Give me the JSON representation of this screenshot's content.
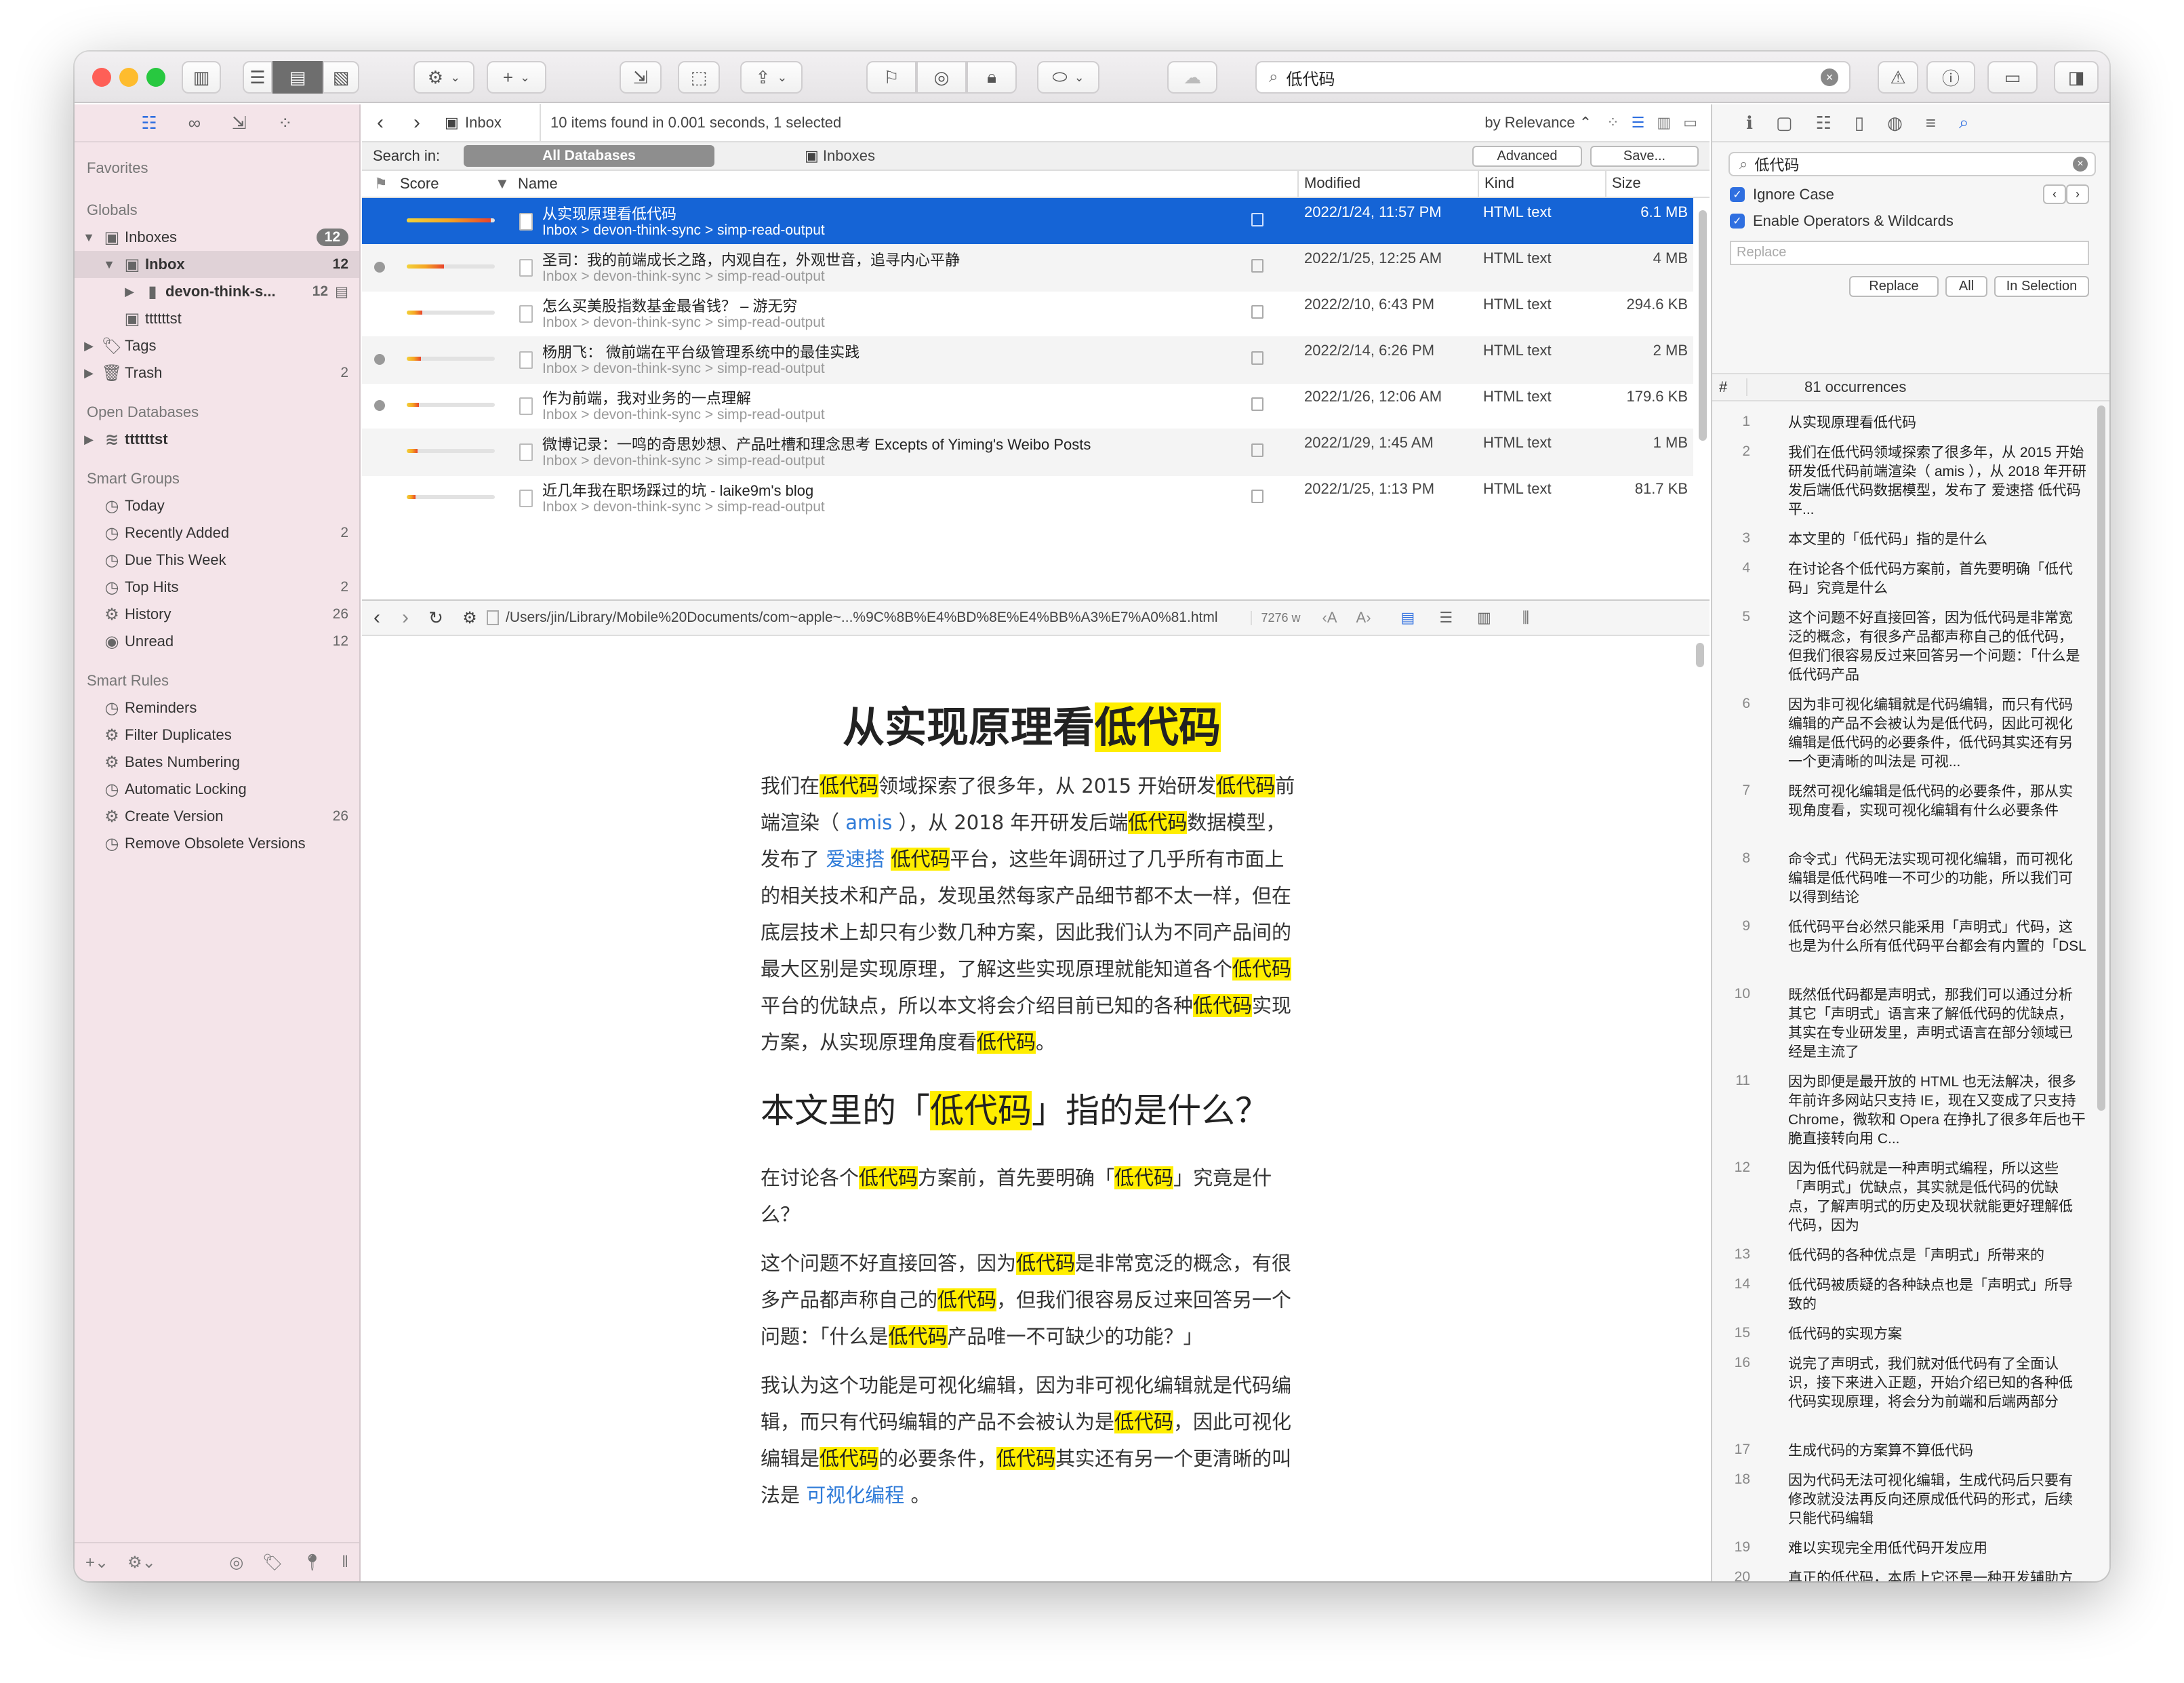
{
  "toolbar": {
    "search_value": "低代码",
    "icons": [
      "sidebar-toggle-icon",
      "view-list-icon",
      "view-split-icon",
      "view-columns-icon",
      "gear-icon",
      "plus-icon",
      "import-icon",
      "capture-icon",
      "share-icon",
      "flag-icon",
      "mark-icon",
      "lock-icon",
      "label-icon",
      "cloud-icon",
      "warning-icon",
      "info-icon",
      "layout-icon",
      "inspector-icon"
    ]
  },
  "sidebar": {
    "favorites_heading": "Favorites",
    "globals_heading": "Globals",
    "globals": [
      {
        "label": "Inboxes",
        "count": "12"
      },
      {
        "label": "Inbox",
        "count": "12"
      },
      {
        "label": "devon-think-s...",
        "count": "12"
      },
      {
        "label": "ttttttst",
        "count": ""
      },
      {
        "label": "Tags",
        "count": ""
      },
      {
        "label": "Trash",
        "count": "2"
      }
    ],
    "open_db_heading": "Open Databases",
    "open_dbs": [
      {
        "label": "ttttttst"
      }
    ],
    "smart_groups_heading": "Smart Groups",
    "smart_groups": [
      {
        "label": "Today",
        "count": ""
      },
      {
        "label": "Recently Added",
        "count": "2"
      },
      {
        "label": "Due This Week",
        "count": ""
      },
      {
        "label": "Top Hits",
        "count": "2"
      },
      {
        "label": "History",
        "count": "26"
      },
      {
        "label": "Unread",
        "count": "12"
      }
    ],
    "smart_rules_heading": "Smart Rules",
    "smart_rules": [
      {
        "label": "Reminders",
        "count": ""
      },
      {
        "label": "Filter Duplicates",
        "count": ""
      },
      {
        "label": "Bates Numbering",
        "count": ""
      },
      {
        "label": "Automatic Locking",
        "count": ""
      },
      {
        "label": "Create Version",
        "count": "26"
      },
      {
        "label": "Remove Obsolete Versions",
        "count": ""
      }
    ]
  },
  "list": {
    "location": "Inbox",
    "status": "10 items found in 0.001 seconds, 1 selected",
    "sort": "by Relevance",
    "search_in_label": "Search in:",
    "scope_all": "All Databases",
    "scope_inboxes": "Inboxes",
    "advanced_label": "Advanced",
    "save_label": "Save...",
    "columns": {
      "score": "Score",
      "name": "Name",
      "modified": "Modified",
      "kind": "Kind",
      "size": "Size"
    },
    "rows": [
      {
        "title": "从实现原理看低代码",
        "path": "Inbox > devon-think-sync > simp-read-output",
        "modified": "2022/1/24, 11:57 PM",
        "kind": "HTML text",
        "size": "6.1 MB",
        "score": 0.95,
        "flag": false,
        "selected": true
      },
      {
        "title": "圣司：我的前端成长之路，内观自在，外观世音，追寻内心平静",
        "path": "Inbox > devon-think-sync > simp-read-output",
        "modified": "2022/1/25, 12:25 AM",
        "kind": "HTML text",
        "size": "4 MB",
        "score": 0.42,
        "flag": true,
        "selected": false
      },
      {
        "title": "怎么买美股指数基金最省钱？ – 游无穷",
        "path": "Inbox > devon-think-sync > simp-read-output",
        "modified": "2022/2/10, 6:43 PM",
        "kind": "HTML text",
        "size": "294.6 KB",
        "score": 0.18,
        "flag": false,
        "selected": false
      },
      {
        "title": "杨朋飞： 微前端在平台级管理系统中的最佳实践",
        "path": "Inbox > devon-think-sync > simp-read-output",
        "modified": "2022/2/14, 6:26 PM",
        "kind": "HTML text",
        "size": "2 MB",
        "score": 0.16,
        "flag": true,
        "selected": false
      },
      {
        "title": "作为前端，我对业务的一点理解",
        "path": "Inbox > devon-think-sync > simp-read-output",
        "modified": "2022/1/26, 12:06 AM",
        "kind": "HTML text",
        "size": "179.6 KB",
        "score": 0.14,
        "flag": true,
        "selected": false
      },
      {
        "title": "微博记录：一鸣的奇思妙想、产品吐槽和理念思考 Excepts of Yiming's Weibo Posts",
        "path": "Inbox > devon-think-sync > simp-read-output",
        "modified": "2022/1/29, 1:45 AM",
        "kind": "HTML text",
        "size": "1 MB",
        "score": 0.12,
        "flag": false,
        "selected": false
      },
      {
        "title": "近几年我在职场踩过的坑 - laike9m's blog",
        "path": "Inbox > devon-think-sync > simp-read-output",
        "modified": "2022/1/25, 1:13 PM",
        "kind": "HTML text",
        "size": "81.7 KB",
        "score": 0.1,
        "flag": false,
        "selected": false
      }
    ]
  },
  "pathbar": {
    "path": "/Users/jin/Library/Mobile%20Documents/com~apple~...%9C%8B%E4%BD%8E%E4%BB%A3%E7%A0%81.html",
    "words": "7276 w"
  },
  "article": {
    "title_pre": "从实现原理看",
    "hl": "低代码",
    "p1": {
      "a": "我们在",
      "b": "领域探索了很多年，从 2015 开始研发",
      "c": "前端渲染（ ",
      "link1": "amis",
      "d": " ），从 2018 年开研发后端",
      "e": "数据模型，发布了 ",
      "link2": "爱速搭",
      "f": " ",
      "g": "平台，这些年调研过了几乎所有市面上的相关技术和产品，发现虽然每家产品细节都不太一样，但在底层技术上却只有少数几种方案，因此我们认为不同产品间的最大区别是实现原理，了解这些实现原理就能知道各个",
      "h": "平台的优缺点，所以本文将会介绍目前已知的各种",
      "i": "实现方案，从实现原理角度看",
      "j": "。"
    },
    "h2": {
      "a": "本文里的「",
      "b": "」指的是什么？"
    },
    "p2": {
      "a": "在讨论各个",
      "b": "方案前，首先要明确「",
      "c": "」究竟是什么？"
    },
    "p3": {
      "a": "这个问题不好直接回答，因为",
      "b": "是非常宽泛的概念，有很多产品都声称自己的",
      "c": "，但我们很容易反过来回答另一个问题：「什么是",
      "d": "产品唯一不可缺少的功能？」"
    },
    "p4": {
      "a": "我认为这个功能是可视化编辑，因为非可视化编辑就是代码编辑，而只有代码编辑的产品不会被认为是",
      "b": "，因此可视化编辑是",
      "c": "的必要条件，",
      "d": "其实还有另一个更清晰的叫法是 ",
      "link": "可视化编程",
      "e": " 。"
    }
  },
  "right_panel": {
    "search_value": "低代码",
    "ignore_case": "Ignore Case",
    "operators": "Enable Operators & Wildcards",
    "replace_placeholder": "Replace",
    "replace_btn": "Replace",
    "all_btn": "All",
    "in_selection_btn": "In Selection",
    "hash": "#",
    "occurrences": "81 occurrences",
    "items": [
      {
        "n": "1",
        "text": "从实现原理看低代码"
      },
      {
        "n": "2",
        "text": "我们在低代码领域探索了很多年，从 2015 开始研发低代码前端渲染（ amis ），从 2018 年开研发后端低代码数据模型，发布了 爱速搭 低代码平..."
      },
      {
        "n": "3",
        "text": "本文里的「低代码」指的是什么"
      },
      {
        "n": "4",
        "text": "在讨论各个低代码方案前，首先要明确「低代码」究竟是什么"
      },
      {
        "n": "5",
        "text": "这个问题不好直接回答，因为低代码是非常宽泛的概念，有很多产品都声称自己的低代码，但我们很容易反过来回答另一个问题：「什么是低代码产品"
      },
      {
        "n": "6",
        "text": "因为非可视化编辑就是代码编辑，而只有代码编辑的产品不会被认为是低代码，因此可视化编辑是低代码的必要条件，低代码其实还有另一个更清晰的叫法是 可视..."
      },
      {
        "n": "7",
        "text": "既然可视化编辑是低代码的必要条件，那从实现角度看，实现可视化编辑有什么必要条件"
      },
      {
        "n": "8",
        "text": "命令式」代码无法实现可视化编辑，而可视化编辑是低代码唯一不可少的功能，所以我们可以得到结论"
      },
      {
        "n": "9",
        "text": "低代码平台必然只能采用「声明式」代码，这也是为什么所有低代码平台都会有内置的「DSL"
      },
      {
        "n": "10",
        "text": "既然低代码都是声明式，那我们可以通过分析其它「声明式」语言来了解低代码的优缺点，其实在专业研发里，声明式语言在部分领域已经是主流了"
      },
      {
        "n": "11",
        "text": "因为即便是最开放的 HTML 也无法解决，很多年前许多网站只支持 IE，现在又变成了只支持 Chrome，微软和 Opera 在挣扎了很多年后也干脆直接转向用 C..."
      },
      {
        "n": "12",
        "text": "因为低代码就是一种声明式编程，所以这些「声明式」优缺点，其实就是低代码的优缺点，了解声明式的历史及现状就能更好理解低代码，因为"
      },
      {
        "n": "13",
        "text": "低代码的各种优点是「声明式」所带来的"
      },
      {
        "n": "14",
        "text": "低代码被质疑的各种缺点也是「声明式」所导致的"
      },
      {
        "n": "15",
        "text": "低代码的实现方案"
      },
      {
        "n": "16",
        "text": "说完了声明式，我们就对低代码有了全面认识，接下来进入正题，开始介绍已知的各种低代码实现原理，将会分为前端和后端两部分"
      },
      {
        "n": "17",
        "text": "生成代码的方案算不算低代码"
      },
      {
        "n": "18",
        "text": "因为代码无法可视化编辑，生成代码后只要有修改就没法再反向还原成低代码的形式，后续只能代码编辑"
      },
      {
        "n": "19",
        "text": "难以实现完全用低代码开发应用"
      },
      {
        "n": "20",
        "text": "真正的低代码，本质上它还是一种开发辅助方式，一种高级点的脚手架工具，和大部分 IDE 的生成样板代码能力一样，使用这种方案无法做到持续可视化开发，我..."
      }
    ]
  }
}
